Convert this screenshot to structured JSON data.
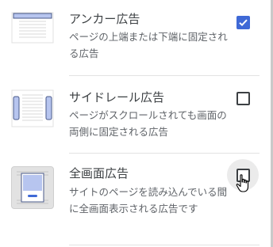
{
  "options": [
    {
      "title": "アンカー広告",
      "description": "ページの上端または下端に固定される広告",
      "checked": true,
      "icon": "anchor-ad-icon"
    },
    {
      "title": "サイドレール広告",
      "description": "ページがスクロールされても画面の両側に固定される広告",
      "checked": false,
      "icon": "side-rail-ad-icon"
    },
    {
      "title": "全画面広告",
      "description": "サイトのページを読み込んでいる間に全画面表示される広告です",
      "checked": false,
      "hovered": true,
      "icon": "vignette-ad-icon"
    }
  ],
  "colors": {
    "checkbox_checked": "#3f69d6",
    "thumb_accent": "#b7c5ef",
    "text_primary": "#3c4043",
    "text_secondary": "#5f6368"
  }
}
